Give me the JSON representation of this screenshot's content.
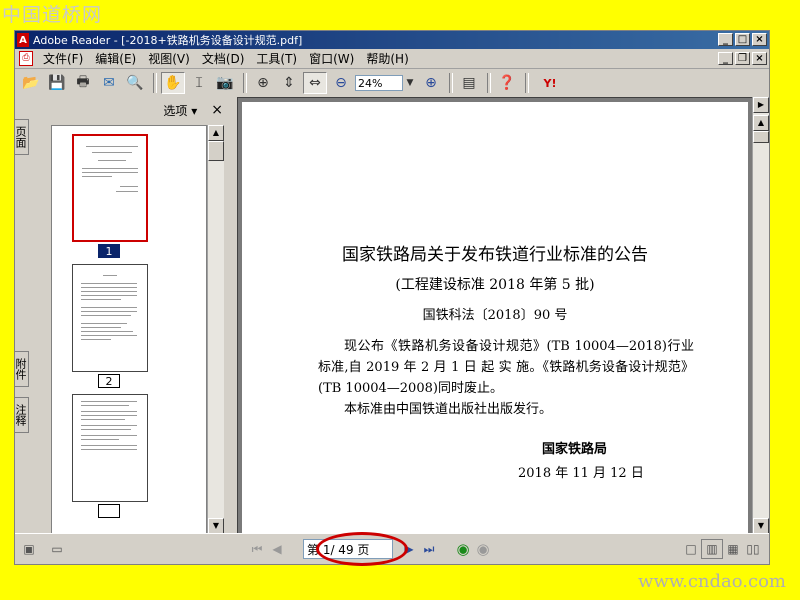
{
  "watermark": {
    "top": "中国道桥网",
    "bottom": "www.cndao.com"
  },
  "window": {
    "title": "Adobe Reader - [-2018+铁路机务设备设计规范.pdf]"
  },
  "menu": [
    "文件(F)",
    "编辑(E)",
    "视图(V)",
    "文档(D)",
    "工具(T)",
    "窗口(W)",
    "帮助(H)"
  ],
  "toolbar": {
    "zoom": "24%"
  },
  "panel": {
    "options": "选项 ▾",
    "close": "×"
  },
  "navtabs": {
    "pages": "页面",
    "attachments": "附件",
    "comments": "注释"
  },
  "thumbnails": [
    {
      "label": "1",
      "selected": true
    },
    {
      "label": "2",
      "selected": false
    },
    {
      "label": "",
      "selected": false
    }
  ],
  "document": {
    "title": "国家铁路局关于发布铁道行业标准的公告",
    "subtitle": "(工程建设标准 2018 年第 5 批)",
    "doc_number": "国铁科法〔2018〕90 号",
    "paragraph1": "现公布《铁路机务设备设计规范》(TB 10004—2018)行业标准,自 2019 年 2 月 1 日 起 实 施。《铁路机务设备设计规范》(TB 10004—2008)同时废止。",
    "paragraph2": "本标准由中国铁道出版社出版发行。",
    "issuer": "国家铁路局",
    "date": "2018 年 11 月 12 日"
  },
  "status": {
    "page_indicator": "第 1/ 49 页"
  },
  "colors": {
    "background": "#ffff00",
    "highlight": "#cc0000",
    "selection": "#0a246a"
  }
}
